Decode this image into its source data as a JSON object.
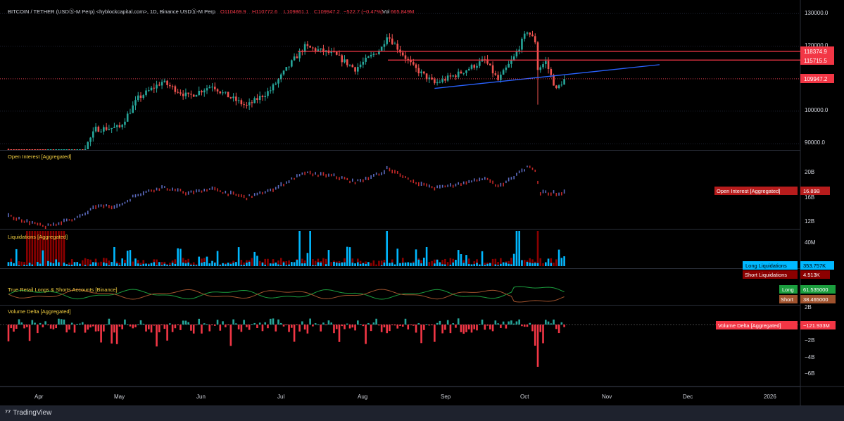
{
  "header": {
    "symbol": "BITCOIN / TETHER (USDⓈ-M Perp) <hyblockcapital.com>, 1D, Binance USDⓈ-M Perp",
    "o": "O110469.9",
    "h": "H110772.6",
    "l": "L109861.1",
    "c": "C109947.2",
    "chg": "−522.7 (−0.47%)",
    "vol_label": "Vol",
    "vol_value": "665.849M"
  },
  "footer": {
    "brand": "TradingView"
  },
  "colors": {
    "up": "#26a69a",
    "down": "#ef5350",
    "price_line": "#f23645",
    "trend": "#2962ff",
    "oi_badge": "#b71c1c",
    "long_liq": "#00b8ff",
    "short_liq": "#8b0000",
    "long_ratio": "#1b9e3e",
    "short_ratio": "#a0522d",
    "delta_up": "#26a69a",
    "delta_down": "#f23645"
  },
  "chart_data": [
    {
      "type": "candlestick",
      "panel": "price",
      "x_axis": {
        "ticks": [
          "Apr",
          "May",
          "Jun",
          "Jul",
          "Aug",
          "Sep",
          "Oct",
          "Nov",
          "Dec",
          "2026"
        ]
      },
      "y_axis": {
        "ticks": [
          "130000.0",
          "120000.0",
          "100000.0",
          "90000.0"
        ],
        "range": [
          85000,
          131000
        ]
      },
      "close_points": [
        {
          "date": "2025-03-24",
          "close": 87300
        },
        {
          "date": "2025-04-07",
          "close": 79000
        },
        {
          "date": "2025-04-21",
          "close": 87500
        },
        {
          "date": "2025-04-26",
          "close": 94500
        },
        {
          "date": "2025-05-05",
          "close": 95000
        },
        {
          "date": "2025-05-12",
          "close": 104000
        },
        {
          "date": "2025-05-21",
          "close": 109000
        },
        {
          "date": "2025-05-31",
          "close": 104500
        },
        {
          "date": "2025-06-09",
          "close": 108000
        },
        {
          "date": "2025-06-13",
          "close": 105500
        },
        {
          "date": "2025-06-22",
          "close": 101500
        },
        {
          "date": "2025-07-01",
          "close": 106500
        },
        {
          "date": "2025-07-10",
          "close": 116000
        },
        {
          "date": "2025-07-14",
          "close": 119800
        },
        {
          "date": "2025-07-25",
          "close": 117500
        },
        {
          "date": "2025-08-02",
          "close": 113000
        },
        {
          "date": "2025-08-12",
          "close": 119500
        },
        {
          "date": "2025-08-14",
          "close": 123500
        },
        {
          "date": "2025-08-24",
          "close": 113500
        },
        {
          "date": "2025-09-01",
          "close": 108500
        },
        {
          "date": "2025-09-10",
          "close": 111500
        },
        {
          "date": "2025-09-20",
          "close": 115700
        },
        {
          "date": "2025-09-25",
          "close": 109500
        },
        {
          "date": "2025-10-01",
          "close": 116500
        },
        {
          "date": "2025-10-06",
          "close": 124700
        },
        {
          "date": "2025-10-09",
          "close": 121500
        },
        {
          "date": "2025-10-10",
          "close": 113000
        },
        {
          "date": "2025-10-13",
          "close": 115200
        },
        {
          "date": "2025-10-17",
          "close": 106500
        },
        {
          "date": "2025-10-20",
          "close": 109947.2
        }
      ],
      "horizontal_lines": [
        {
          "label": "118374.9",
          "value": 118374.9
        },
        {
          "label": "115715.5",
          "value": 115715.5
        }
      ],
      "trendline": {
        "from": {
          "date": "2025-09-01",
          "value": 107000
        },
        "to": {
          "date": "2025-11-25",
          "value": 114300
        }
      },
      "last_price_label": "109947.2"
    },
    {
      "type": "bar",
      "panel": "open_interest",
      "title": "Open Interest [Aggregated]",
      "y_axis": {
        "ticks": [
          "20B",
          "16B",
          "12B"
        ]
      },
      "badge": {
        "name": "Open Interest [Aggregated]",
        "value": "16.89B"
      }
    },
    {
      "type": "bar",
      "panel": "liquidations",
      "title": "Liquidations [Aggregated]",
      "y_axis": {
        "ticks": [
          "40M"
        ]
      },
      "series": [
        {
          "name": "Long Liquidations",
          "last": "353.757K"
        },
        {
          "name": "Short Liquidations",
          "last": "4.513K"
        }
      ]
    },
    {
      "type": "line",
      "panel": "retail_ratio",
      "title": "True Retail Longs & Shorts Accounts [Binance]",
      "series": [
        {
          "name": "Long",
          "last": "61.535000"
        },
        {
          "name": "Short",
          "last": "38.465000"
        }
      ]
    },
    {
      "type": "bar",
      "panel": "volume_delta",
      "title": "Volume Delta [Aggregated]",
      "y_axis": {
        "ticks": [
          "2B",
          "−2B",
          "−4B",
          "−6B"
        ]
      },
      "badge": {
        "name": "Volume Delta [Aggregated]",
        "value": "−121.933M"
      }
    }
  ]
}
